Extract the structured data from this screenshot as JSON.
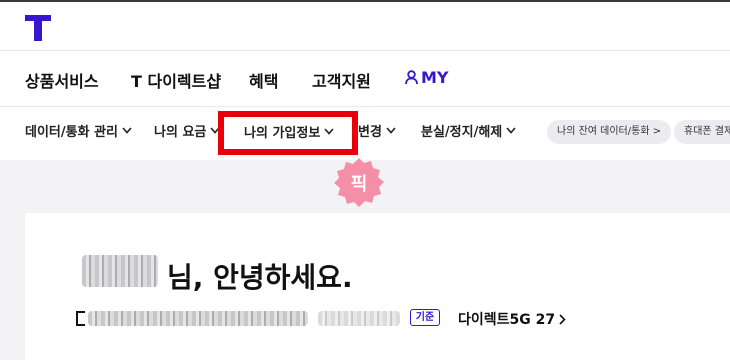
{
  "gnb": {
    "items": [
      "상품서비스",
      "T 다이렉트샵",
      "혜택",
      "고객지원"
    ],
    "my_label": "MY"
  },
  "lnb": {
    "items": [
      "데이터/통화 관리",
      "나의 요금",
      "나의 가입정보",
      "변경",
      "분실/정지/해제"
    ],
    "chips": [
      "나의 잔여 데이터/통화 >",
      "휴대폰 결제"
    ]
  },
  "badge": {
    "pick_label": "픽"
  },
  "card": {
    "greeting": "님, 안녕하세요.",
    "basic_badge": "기준",
    "plan_name": "다이렉트5G 27"
  },
  "colors": {
    "brand": "#3617ce",
    "highlight": "#e8000b",
    "badge_pink": "#f58ea9"
  }
}
